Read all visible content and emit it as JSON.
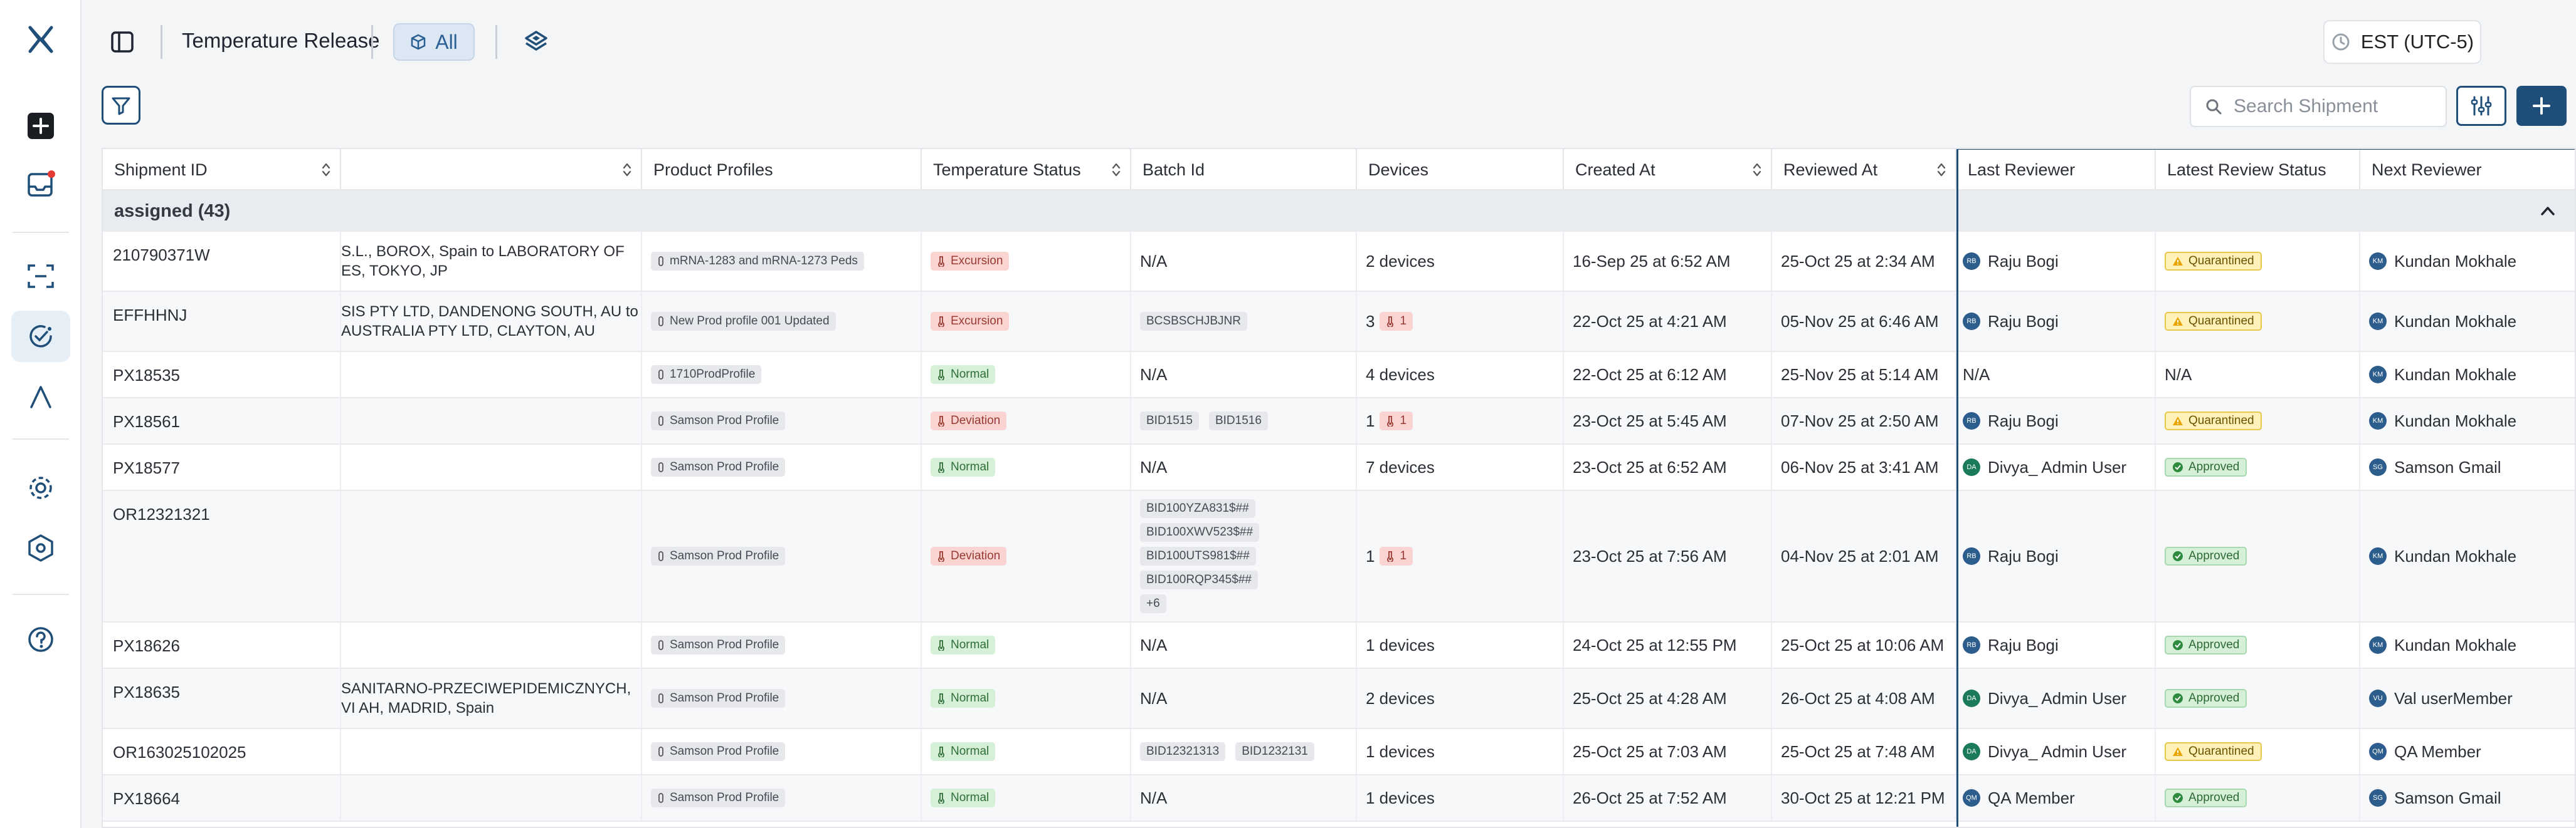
{
  "sidebar": {
    "items": [
      {
        "name": "logo",
        "icon": "x-logo-icon"
      },
      {
        "name": "create",
        "icon": "plus-square-icon"
      },
      {
        "name": "inbox",
        "icon": "inbox-icon",
        "badge": true
      },
      {
        "name": "scan",
        "icon": "scan-icon"
      },
      {
        "name": "shipments",
        "icon": "check-circle-icon",
        "active": true
      },
      {
        "name": "analytics",
        "icon": "lambda-icon"
      },
      {
        "name": "settings",
        "icon": "gear-icon"
      },
      {
        "name": "security",
        "icon": "shield-gear-icon"
      },
      {
        "name": "help",
        "icon": "help-icon"
      }
    ]
  },
  "header": {
    "title": "Temperature Release",
    "all_label": "All",
    "timezone": "EST (UTC-5)"
  },
  "toolbar": {
    "search_placeholder": "Search Shipment"
  },
  "table": {
    "columns": [
      "Shipment ID",
      "",
      "Product Profiles",
      "Temperature Status",
      "Batch Id",
      "Devices",
      "Created At",
      "Reviewed At",
      "Last Reviewer",
      "Latest Review Status",
      "Next Reviewer"
    ],
    "group_label": "assigned (43)",
    "rows": [
      {
        "id": "210790371W",
        "route": "S.L., BOROX, Spain to LABORATORY OF\nES, TOKYO, JP",
        "profile": "mRNA-1283 and mRNA-1273 Peds",
        "temp": "Excursion",
        "batches": [
          "N/A"
        ],
        "devices": "2 devices",
        "alarms": "",
        "created": "16-Sep 25 at 6:52 AM",
        "reviewed": "25-Oct 25 at 2:34 AM",
        "last_reviewer": "Raju Bogi",
        "last_initials": "RB",
        "status": "Quarantined",
        "next_reviewer": "Kundan Mokhale",
        "next_initials": "KM"
      },
      {
        "id": "EFFHHNJ",
        "route": "SIS PTY LTD, DANDENONG SOUTH, AU to\n AUSTRALIA PTY LTD, CLAYTON, AU",
        "profile": "New Prod profile 001 Updated",
        "temp": "Excursion",
        "batches": [
          "BCSBSCHJBJNR"
        ],
        "devices": "3",
        "alarms": "1",
        "created": "22-Oct 25 at 4:21 AM",
        "reviewed": "05-Nov 25 at 6:46 AM",
        "last_reviewer": "Raju Bogi",
        "last_initials": "RB",
        "status": "Quarantined",
        "next_reviewer": "Kundan Mokhale",
        "next_initials": "KM"
      },
      {
        "id": "PX18535",
        "route": "",
        "profile": "1710ProdProfile",
        "temp": "Normal",
        "batches": [
          "N/A"
        ],
        "devices": "4 devices",
        "alarms": "",
        "created": "22-Oct 25 at 6:12 AM",
        "reviewed": "25-Nov 25 at 5:14 AM",
        "last_reviewer": "N/A",
        "last_initials": "",
        "status": "N/A",
        "next_reviewer": "Kundan Mokhale",
        "next_initials": "KM"
      },
      {
        "id": "PX18561",
        "route": "",
        "profile": "Samson Prod Profile",
        "temp": "Deviation",
        "batches": [
          "BID1515",
          "BID1516"
        ],
        "devices": "1",
        "alarms": "1",
        "created": "23-Oct 25 at 5:45 AM",
        "reviewed": "07-Nov 25 at 2:50 AM",
        "last_reviewer": "Raju Bogi",
        "last_initials": "RB",
        "status": "Quarantined",
        "next_reviewer": "Kundan Mokhale",
        "next_initials": "KM"
      },
      {
        "id": "PX18577",
        "route": "",
        "profile": "Samson Prod Profile",
        "temp": "Normal",
        "batches": [
          "N/A"
        ],
        "devices": "7 devices",
        "alarms": "",
        "created": "23-Oct 25 at 6:52 AM",
        "reviewed": "06-Nov 25 at 3:41 AM",
        "last_reviewer": "Divya_ Admin User",
        "last_initials": "DA",
        "status": "Approved",
        "next_reviewer": "Samson Gmail",
        "next_initials": "SG"
      },
      {
        "id": "OR12321321",
        "route": "",
        "profile": "Samson Prod Profile",
        "temp": "Deviation",
        "batches": [
          "BID100YZA831$##",
          "BID100XWV523$##",
          "BID100UTS981$##",
          "BID100RQP345$##",
          "+6"
        ],
        "devices": "1",
        "alarms": "1",
        "created": "23-Oct 25 at 7:56 AM",
        "reviewed": "04-Nov 25 at 2:01 AM",
        "last_reviewer": "Raju Bogi",
        "last_initials": "RB",
        "status": "Approved",
        "next_reviewer": "Kundan Mokhale",
        "next_initials": "KM"
      },
      {
        "id": "PX18626",
        "route": "",
        "profile": "Samson Prod Profile",
        "temp": "Normal",
        "batches": [
          "N/A"
        ],
        "devices": "1 devices",
        "alarms": "",
        "created": "24-Oct 25 at 12:55 PM",
        "reviewed": "25-Oct 25 at 10:06 AM",
        "last_reviewer": "Raju Bogi",
        "last_initials": "RB",
        "status": "Approved",
        "next_reviewer": "Kundan Mokhale",
        "next_initials": "KM"
      },
      {
        "id": "PX18635",
        "route": "SANITARNO-PRZECIWEPIDEMICZNYCH,\n VI AH, MADRID, Spain",
        "profile": "Samson Prod Profile",
        "temp": "Normal",
        "batches": [
          "N/A"
        ],
        "devices": "2 devices",
        "alarms": "",
        "created": "25-Oct 25 at 4:28 AM",
        "reviewed": "26-Oct 25 at 4:08 AM",
        "last_reviewer": "Divya_ Admin User",
        "last_initials": "DA",
        "status": "Approved",
        "next_reviewer": "Val userMember",
        "next_initials": "VU"
      },
      {
        "id": "OR163025102025",
        "route": "",
        "profile": "Samson Prod Profile",
        "temp": "Normal",
        "batches": [
          "BID12321313",
          "BID1232131"
        ],
        "devices": "1 devices",
        "alarms": "",
        "created": "25-Oct 25 at 7:03 AM",
        "reviewed": "25-Oct 25 at 7:48 AM",
        "last_reviewer": "Divya_ Admin User",
        "last_initials": "DA",
        "status": "Quarantined",
        "next_reviewer": "QA Member",
        "next_initials": "QM"
      },
      {
        "id": "PX18664",
        "route": "",
        "profile": "Samson Prod Profile",
        "temp": "Normal",
        "batches": [
          "N/A"
        ],
        "devices": "1 devices",
        "alarms": "",
        "created": "26-Oct 25 at 7:52 AM",
        "reviewed": "30-Oct 25 at 12:21 PM",
        "last_reviewer": "QA Member",
        "last_initials": "QM",
        "status": "Approved",
        "next_reviewer": "Samson Gmail",
        "next_initials": "SG"
      }
    ]
  },
  "colors": {
    "brand": "#1f4e79",
    "excursion": "#f9d4d1",
    "normal": "#d6f0d8",
    "quarantined": "#fff1b8",
    "approved": "#d6f0d8",
    "alert_dot": "#e53935"
  }
}
